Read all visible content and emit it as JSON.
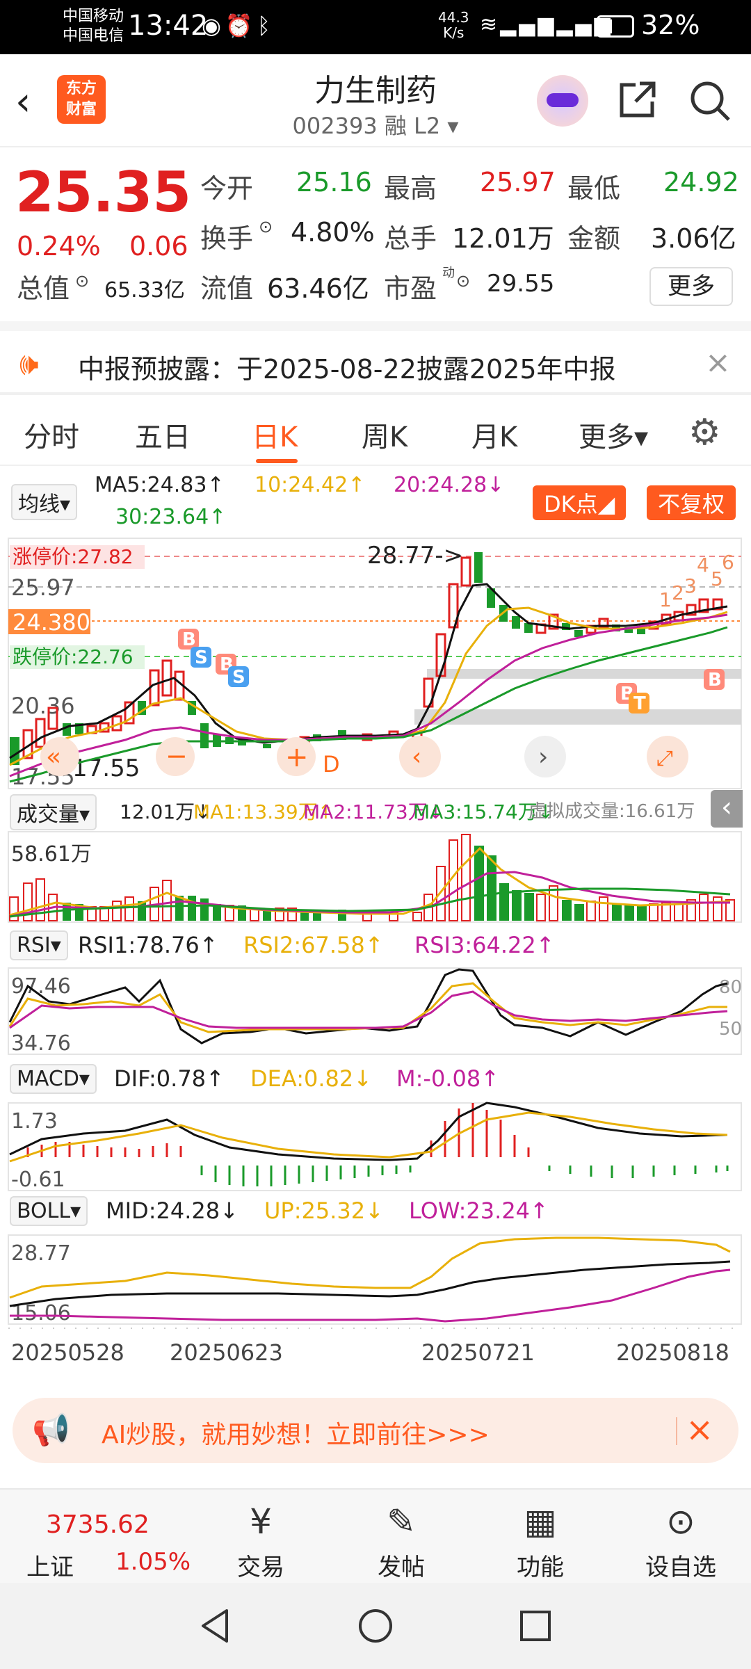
{
  "status": {
    "carrier1": "中国移动",
    "carrier2": "中国电信",
    "time": "13:42",
    "net_speed": "44.3",
    "net_unit": "K/s",
    "battery": "32%"
  },
  "header": {
    "back_icon": "chevron-left-icon",
    "logo": "东方财富",
    "stock_name": "力生制药",
    "stock_code": "002393 融 L2 ▾"
  },
  "quote": {
    "price": "25.35",
    "pct": "0.24%",
    "chg": "0.06",
    "open_label": "今开",
    "open": "25.16",
    "high_label": "最高",
    "high": "25.97",
    "low_label": "最低",
    "low": "24.92",
    "turnover_label": "换手",
    "turnover": "4.80%",
    "volume_label": "总手",
    "volume": "12.01万",
    "amount_label": "金额",
    "amount": "3.06亿",
    "mktcap_label": "总值",
    "mktcap": "65.33亿",
    "float_label": "流值",
    "float": "63.46亿",
    "pe_label": "市盈",
    "pe_sup": "动",
    "pe": "29.55",
    "more": "更多"
  },
  "notice": {
    "text": "中报预披露：于2025-08-22披露2025年中报",
    "close": "×"
  },
  "tabs": [
    "分时",
    "五日",
    "日K",
    "周K",
    "月K",
    "更多▾"
  ],
  "ma": {
    "selector": "均线▾",
    "ma5": "MA5:24.83↑",
    "ma10": "10:24.42↑",
    "ma20": "20:24.28↓",
    "ma30": "30:23.64↑",
    "dk_button": "DK点◢",
    "adjust_button": "不复权"
  },
  "kline": {
    "limit_up": "涨停价:27.82",
    "limit_down": "跌停价:22.76",
    "level1": "25.97",
    "level_current": "24.380",
    "level2": "20.36",
    "level_low_left": "17.55",
    "peak_label": "28.77->",
    "low_label": "17.55",
    "mark_d": "D",
    "markers": [
      "B",
      "S",
      "B",
      "S",
      "B",
      "T",
      "B"
    ],
    "nums": [
      "1",
      "2",
      "3",
      "4",
      "5",
      "6"
    ]
  },
  "volume": {
    "selector": "成交量▾",
    "vol": "12.01万↓",
    "ma1": "MA1:13.39万↑",
    "ma2": "MA2:11.73万↓",
    "ma3": "MA3:15.74万↓",
    "virtual": "虚拟成交量:16.61万",
    "max_label": "58.61万"
  },
  "rsi": {
    "selector": "RSI▾",
    "rsi1": "RSI1:78.76↑",
    "rsi2": "RSI2:67.58↑",
    "rsi3": "RSI3:64.22↑",
    "top": "97.46",
    "bottom": "34.76",
    "ref80": "80",
    "ref50": "50"
  },
  "macd": {
    "selector": "MACD▾",
    "dif": "DIF:0.78↑",
    "dea": "DEA:0.82↓",
    "m": "M:-0.08↑",
    "top": "1.73",
    "bottom": "-0.61"
  },
  "boll": {
    "selector": "BOLL▾",
    "mid": "MID:24.28↓",
    "up": "UP:25.32↓",
    "low": "LOW:23.24↑",
    "top": "28.77",
    "bottom": "15.06"
  },
  "dates": [
    "20250528",
    "20250623",
    "20250721",
    "20250818"
  ],
  "ai_banner": {
    "text": "AI炒股，就用妙想！立即前往>>>",
    "close": "×"
  },
  "bottom_nav": {
    "index_value": "3735.62",
    "index_name": "上证",
    "index_pct": "1.05%",
    "items": [
      "交易",
      "发帖",
      "功能",
      "设自选"
    ]
  },
  "colors": {
    "up": "#e02020",
    "down": "#1a9a2a",
    "accent": "#ff5a1f"
  }
}
